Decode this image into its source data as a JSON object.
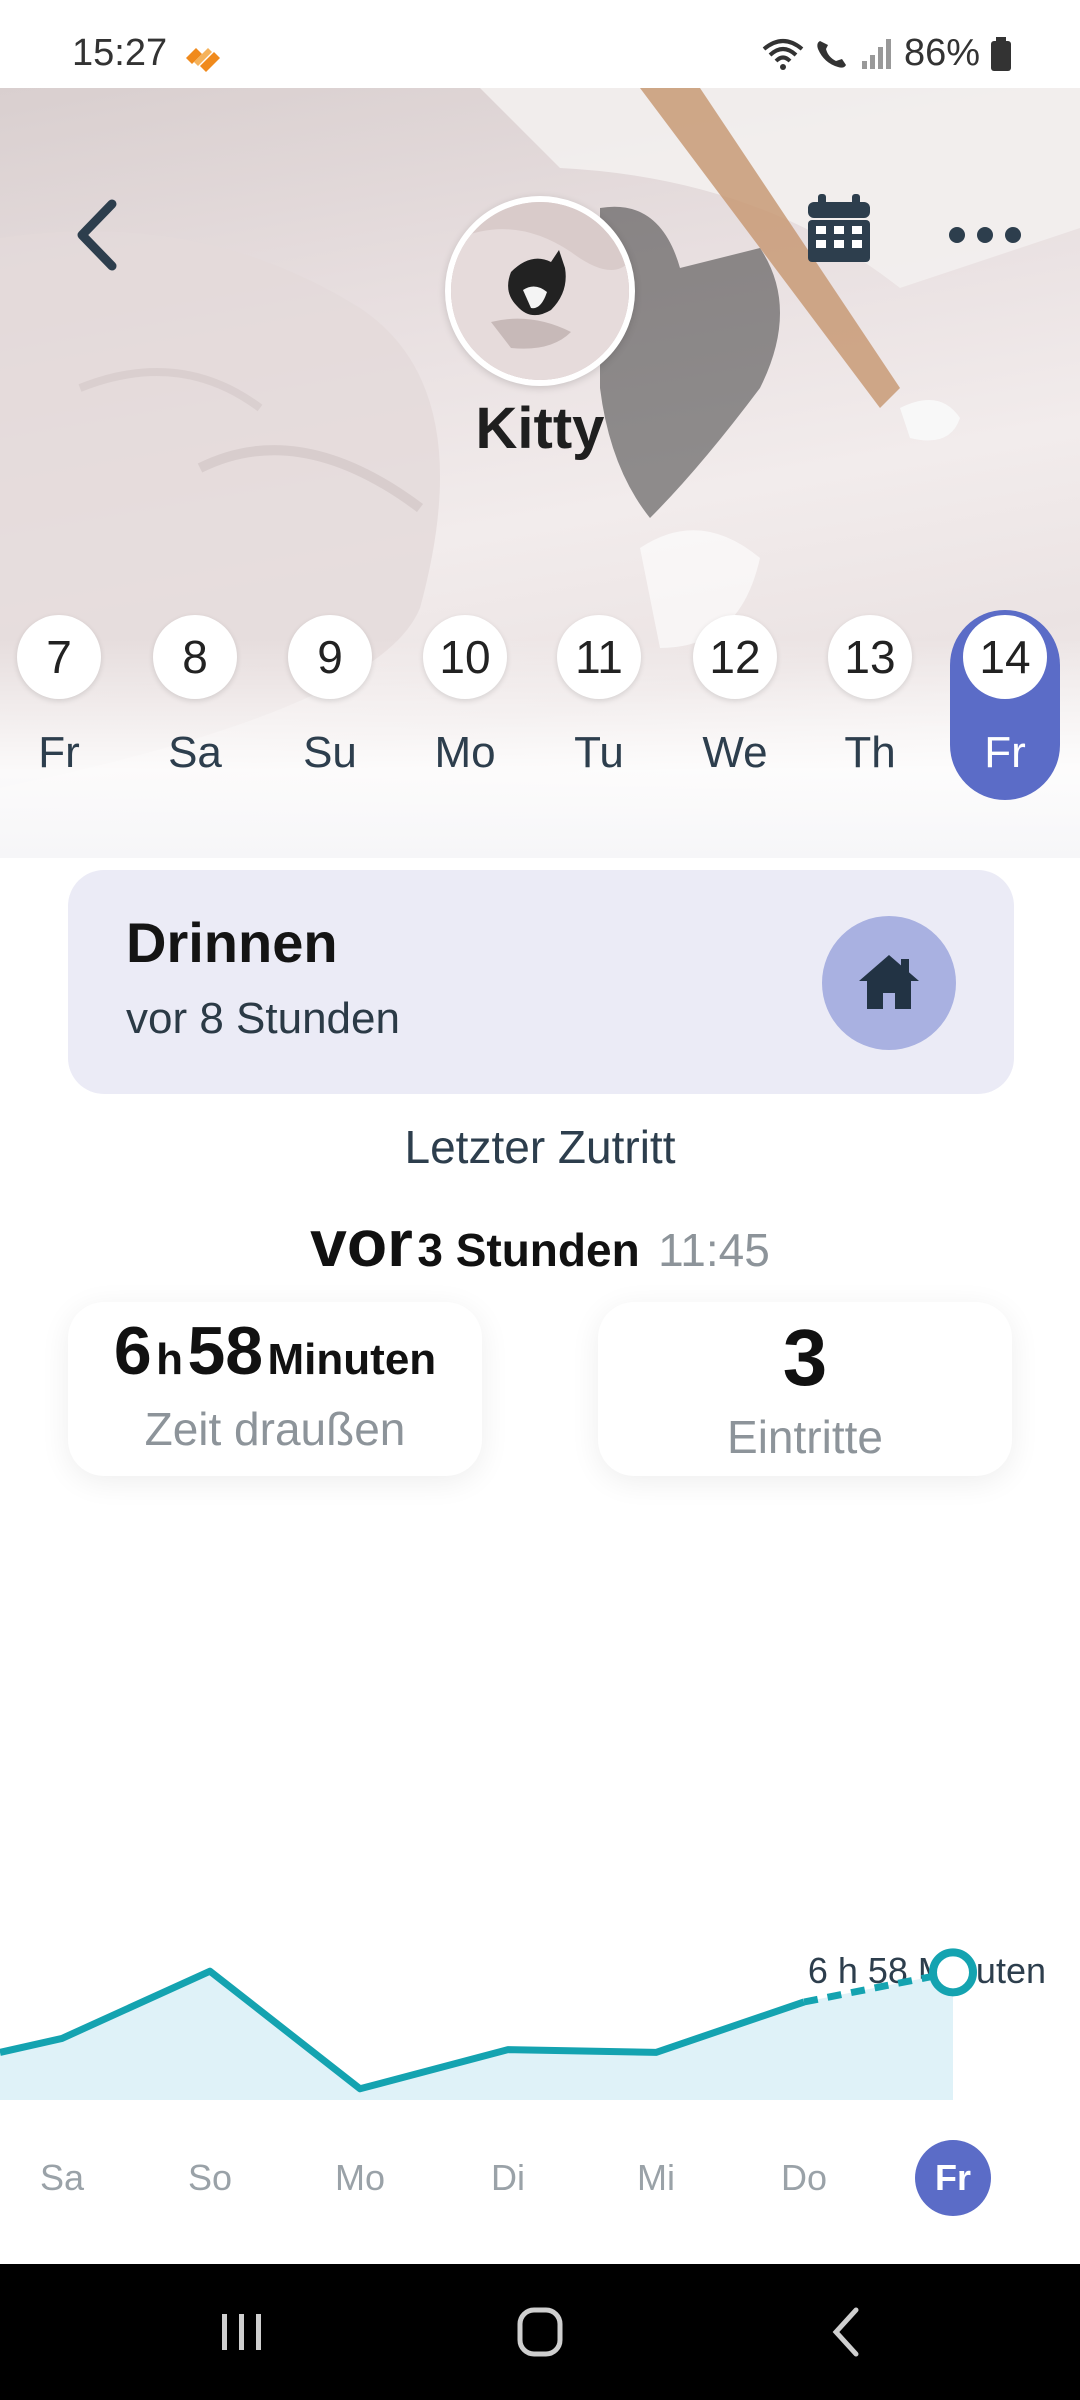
{
  "status_bar": {
    "time": "15:27",
    "battery": "86%",
    "app_icon": "app-notification-icon"
  },
  "header": {
    "pet_name": "Kitty",
    "back_icon": "chevron-left-icon",
    "calendar_icon": "calendar-icon",
    "more_icon": "more-horizontal-icon"
  },
  "days": [
    {
      "num": "7",
      "wd": "Fr",
      "active": false
    },
    {
      "num": "8",
      "wd": "Sa",
      "active": false
    },
    {
      "num": "9",
      "wd": "Su",
      "active": false
    },
    {
      "num": "10",
      "wd": "Mo",
      "active": false
    },
    {
      "num": "11",
      "wd": "Tu",
      "active": false
    },
    {
      "num": "12",
      "wd": "We",
      "active": false
    },
    {
      "num": "13",
      "wd": "Th",
      "active": false
    },
    {
      "num": "14",
      "wd": "Fr",
      "active": true
    }
  ],
  "status_card": {
    "title": "Drinnen",
    "subtitle": "vor 8 Stunden",
    "icon": "home-icon"
  },
  "last_entry": {
    "label": "Letzter Zutritt",
    "prefix": "vor",
    "value": "3 Stunden",
    "time": "11:45"
  },
  "stats": {
    "outside_hours": "6",
    "outside_hours_unit": "h",
    "outside_minutes": "58",
    "outside_minutes_unit": "Minuten",
    "outside_label": "Zeit draußen",
    "entries": "3",
    "entries_label": "Eintritte"
  },
  "chart_data": {
    "type": "area",
    "categories": [
      "Sa",
      "So",
      "Mo",
      "Di",
      "Mi",
      "Do",
      "Fr"
    ],
    "values": [
      300,
      420,
      210,
      280,
      275,
      365,
      418
    ],
    "highlight_label": "6 h 58 Minuten",
    "active_category": "Fr",
    "color": "#14a3b0",
    "fill": "#dff2f8"
  },
  "nav": {
    "recent_icon": "recent-apps-icon",
    "home_icon": "home-circle-icon",
    "back_icon": "back-icon"
  }
}
